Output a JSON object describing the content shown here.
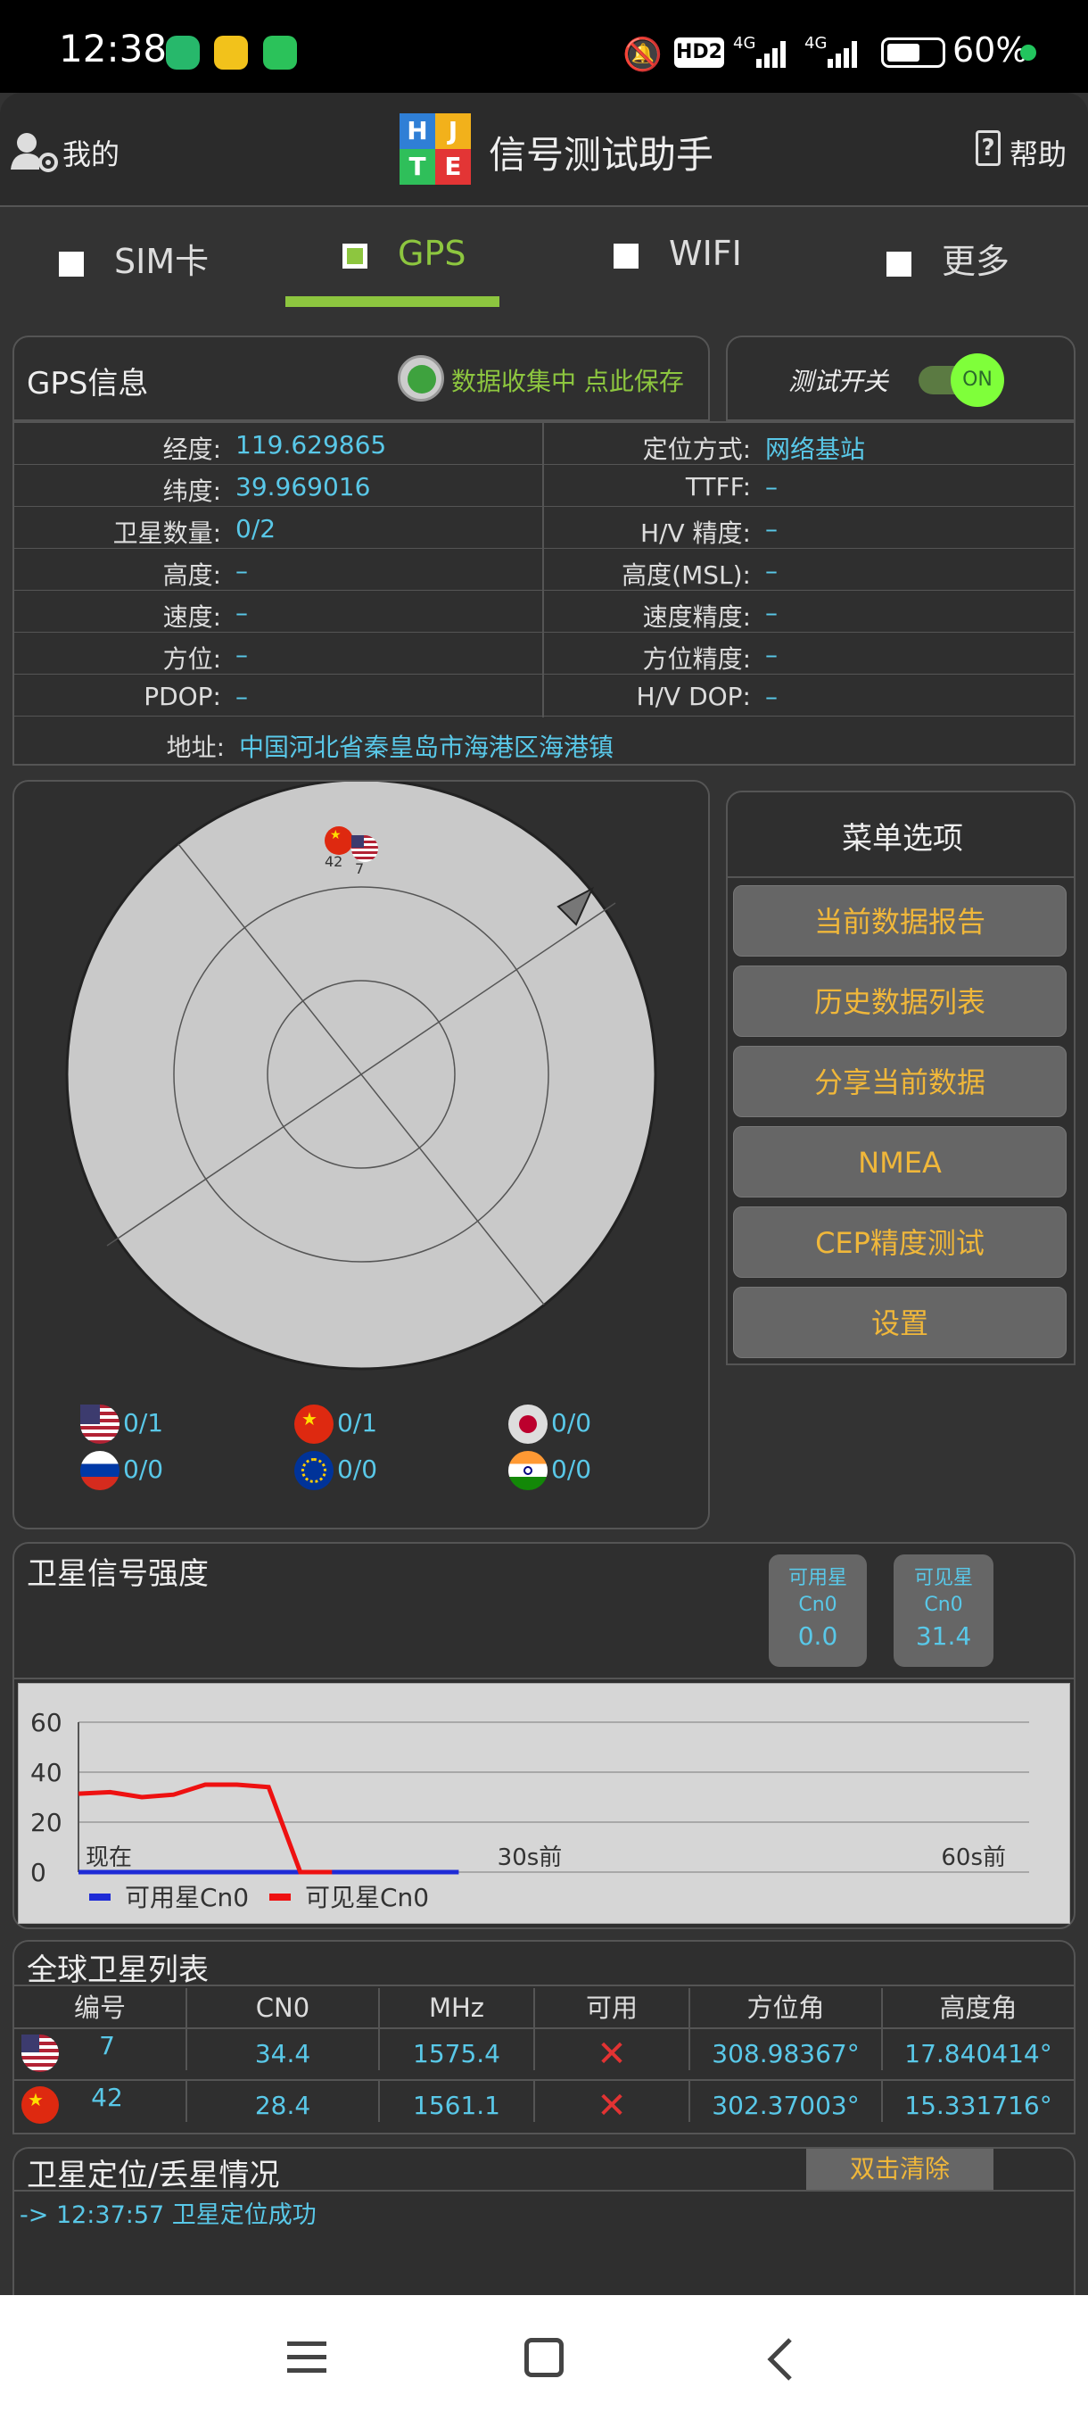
{
  "status_bar": {
    "time": "12:38",
    "network_a": "4G",
    "network_b": "4G",
    "hd": "HD2",
    "battery": "60%"
  },
  "header": {
    "left_label": "我的",
    "title": "信号测试助手",
    "right_label": "帮助",
    "logo_letters": [
      "H",
      "J",
      "T",
      "E"
    ]
  },
  "tabs": [
    {
      "label": "SIM卡",
      "active": false
    },
    {
      "label": "GPS",
      "active": true
    },
    {
      "label": "WIFI",
      "active": false
    },
    {
      "label": "更多",
      "active": false
    }
  ],
  "gps_info": {
    "title": "GPS信息",
    "collect_status": "数据收集中 点此保存",
    "test_switch_label": "测试开关",
    "toggle": "ON",
    "rows": [
      {
        "l1": "经度:",
        "v1": "119.629865",
        "l2": "定位方式:",
        "v2": "网络基站"
      },
      {
        "l1": "纬度:",
        "v1": "39.969016",
        "l2": "TTFF:",
        "v2": "–"
      },
      {
        "l1": "卫星数量:",
        "v1": "0/2",
        "l2": "H/V 精度:",
        "v2": "–"
      },
      {
        "l1": "高度:",
        "v1": "–",
        "l2": "高度(MSL):",
        "v2": "–"
      },
      {
        "l1": "速度:",
        "v1": "–",
        "l2": "速度精度:",
        "v2": "–"
      },
      {
        "l1": "方位:",
        "v1": "–",
        "l2": "方位精度:",
        "v2": "–"
      },
      {
        "l1": "PDOP:",
        "v1": "–",
        "l2": "H/V DOP:",
        "v2": "–"
      }
    ],
    "address_label": "地址:",
    "address": "中国河北省秦皇岛市海港区海港镇"
  },
  "sky": {
    "sat_labels": [
      "42",
      "7"
    ],
    "counts": {
      "us": "0/1",
      "cn": "0/1",
      "jp": "0/0",
      "ru": "0/0",
      "eu": "0/0",
      "in": "0/0"
    }
  },
  "menu": {
    "title": "菜单选项",
    "items": [
      "当前数据报告",
      "历史数据列表",
      "分享当前数据",
      "NMEA",
      "CEP精度测试",
      "设置"
    ]
  },
  "signal": {
    "title": "卫星信号强度",
    "usable_label_1": "可用星",
    "usable_label_2": "Cn0",
    "usable_value": "0.0",
    "visible_label_1": "可见星",
    "visible_label_2": "Cn0",
    "visible_value": "31.4"
  },
  "chart_data": {
    "type": "line",
    "y_ticks": [
      "60",
      "40",
      "20",
      "0"
    ],
    "ylim": [
      0,
      60
    ],
    "x_labels": [
      "现在",
      "30s前",
      "60s前"
    ],
    "series": [
      {
        "name": "可用星Cn0",
        "color": "#1e2bd6",
        "values": [
          0,
          0,
          0,
          0,
          0,
          0,
          0,
          0,
          0,
          0,
          0,
          0,
          0
        ]
      },
      {
        "name": "可见星Cn0",
        "color": "#ee1111",
        "values": [
          31.4,
          32,
          30,
          31,
          35,
          35,
          34,
          0,
          0
        ]
      }
    ]
  },
  "sat_table": {
    "title": "全球卫星列表",
    "headers": [
      "编号",
      "CN0",
      "MHz",
      "可用",
      "方位角",
      "高度角"
    ],
    "rows": [
      {
        "flag": "us",
        "id": "7",
        "cn0": "34.4",
        "mhz": "1575.4",
        "usable": "✕",
        "azimuth": "308.98367°",
        "elevation": "17.840414°"
      },
      {
        "flag": "cn",
        "id": "42",
        "cn0": "28.4",
        "mhz": "1561.1",
        "usable": "✕",
        "azimuth": "302.37003°",
        "elevation": "15.331716°"
      }
    ]
  },
  "fix_log": {
    "title": "卫星定位/丢星情况",
    "clear_button": "双击清除",
    "entries": [
      "-> 12:37:57 卫星定位成功"
    ]
  },
  "nav": {
    "menu_icon": "menu-icon",
    "home_icon": "home-icon",
    "back_icon": "back-icon"
  }
}
